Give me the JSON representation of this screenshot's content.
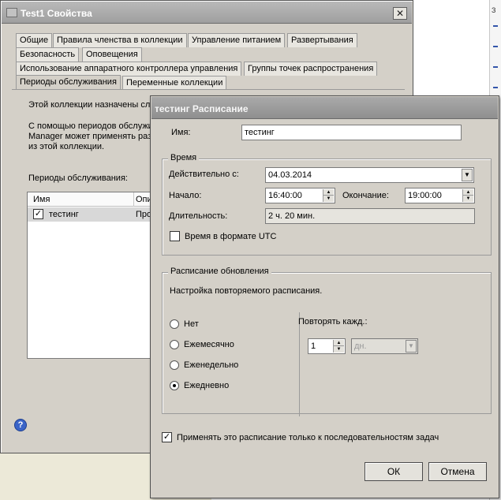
{
  "parent_window": {
    "title": "Test1 Свойства",
    "tabs_row1": [
      "Общие",
      "Правила членства в коллекции",
      "Управление питанием",
      "Развертывания"
    ],
    "tabs_row2": [
      "Безопасность",
      "Оповещения"
    ],
    "tabs_row3": [
      "Использование аппаратного контроллера управления",
      "Группы точек распространения"
    ],
    "tabs_row4": [
      "Периоды обслуживания",
      "Переменные коллекции"
    ],
    "active_tab": "Периоды обслуживания",
    "intro_text": "Этой коллекции назначены сл",
    "desc_line1": "С помощью периодов обслужи",
    "desc_line2": "Manager может применять раз",
    "desc_line3": "из этой коллекции.",
    "windows_label": "Периоды обслуживания:",
    "list": {
      "col_name": "Имя",
      "col_desc": "Опи",
      "rows": [
        {
          "name": "тестинг",
          "desc": "Про",
          "checked": true
        }
      ]
    }
  },
  "schedule_dialog": {
    "title": "тестинг Расписание",
    "name_label": "Имя:",
    "name_value": "тестинг",
    "time_group": "Время",
    "effective_label": "Действительно с:",
    "effective_value": "04.03.2014",
    "start_label": "Начало:",
    "start_value": "16:40:00",
    "end_label": "Окончание:",
    "end_value": "19:00:00",
    "duration_label": "Длительность:",
    "duration_value": "2 ч. 20 мин.",
    "utc_label": "Время в формате UTC",
    "utc_checked": false,
    "recurrence_group": "Расписание обновления",
    "recurrence_hint": "Настройка повторяемого расписания.",
    "options": [
      "Нет",
      "Ежемесячно",
      "Еженедельно",
      "Ежедневно"
    ],
    "selected_option": "Ежедневно",
    "repeat_label": "Повторять кажд.:",
    "repeat_value": "1",
    "repeat_unit": "дн.",
    "apply_label": "Применять это расписание только к последовательностям задач",
    "apply_checked": true,
    "ok_label": "ОК",
    "cancel_label": "Отмена"
  },
  "right_strip_text": "З"
}
